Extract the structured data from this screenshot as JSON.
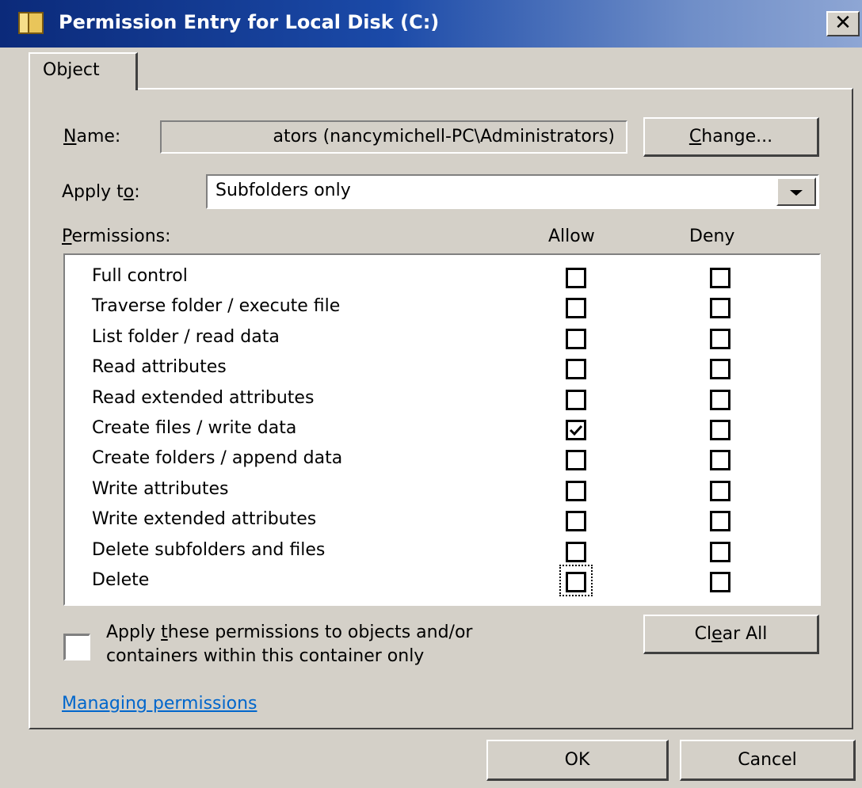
{
  "window": {
    "title": "Permission Entry for Local Disk (C:)",
    "close_label": "✕",
    "icon": "folder-icon"
  },
  "tabs": [
    {
      "label": "Object",
      "selected": true
    }
  ],
  "name": {
    "label_pre": "",
    "label_u": "N",
    "label_post": "ame:",
    "value": "ators (nancymichell-PC\\Administrators)",
    "change_button_u": "C",
    "change_button_post": "hange..."
  },
  "apply_to": {
    "label_pre": "Apply t",
    "label_u": "o",
    "label_post": ":",
    "value": "Subfolders only"
  },
  "permissions": {
    "label_u": "P",
    "label_post": "ermissions:",
    "allow_header": "Allow",
    "deny_header": "Deny",
    "rows": [
      {
        "label": "Full control",
        "allow": false,
        "deny": false
      },
      {
        "label": "Traverse folder / execute file",
        "allow": false,
        "deny": false
      },
      {
        "label": "List folder / read data",
        "allow": false,
        "deny": false
      },
      {
        "label": "Read attributes",
        "allow": false,
        "deny": false
      },
      {
        "label": "Read extended attributes",
        "allow": false,
        "deny": false
      },
      {
        "label": "Create files / write data",
        "allow": true,
        "deny": false
      },
      {
        "label": "Create folders / append data",
        "allow": false,
        "deny": false
      },
      {
        "label": "Write attributes",
        "allow": false,
        "deny": false
      },
      {
        "label": "Write extended attributes",
        "allow": false,
        "deny": false
      },
      {
        "label": "Delete subfolders and files",
        "allow": false,
        "deny": false
      },
      {
        "label": "Delete",
        "allow": false,
        "deny": false
      }
    ]
  },
  "apply_within": {
    "line1_pre": "Apply ",
    "line1_u": "t",
    "line1_post": "hese permissions to objects and/or",
    "line2": "containers within this container only",
    "checked": false
  },
  "clear_all": {
    "pre": "Cl",
    "u": "e",
    "post": "ar All"
  },
  "help_link": "Managing permissions",
  "footer": {
    "ok": "OK",
    "cancel": "Cancel"
  }
}
